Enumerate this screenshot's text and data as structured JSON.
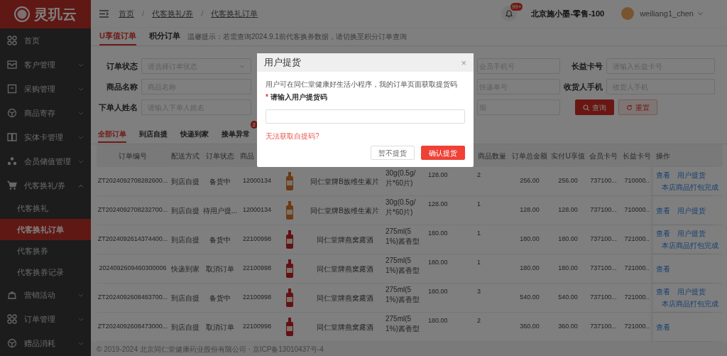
{
  "logo": {
    "text": "灵玑云"
  },
  "sidebar": {
    "items": [
      {
        "label": "首页",
        "kind": "link",
        "selected": false
      },
      {
        "label": "客户管理",
        "kind": "group",
        "expanded": false
      },
      {
        "label": "采购管理",
        "kind": "group",
        "expanded": false
      },
      {
        "label": "商品寄存",
        "kind": "group",
        "expanded": false
      },
      {
        "label": "实体卡管理",
        "kind": "group",
        "expanded": false
      },
      {
        "label": "会员储值管理",
        "kind": "group",
        "expanded": false
      },
      {
        "label": "代客换礼/券",
        "kind": "group",
        "expanded": true,
        "children": [
          {
            "label": "代客换礼",
            "selected": false
          },
          {
            "label": "代客换礼订单",
            "selected": true
          },
          {
            "label": "代客换券",
            "selected": false
          },
          {
            "label": "代客换券记录",
            "selected": false
          }
        ]
      },
      {
        "label": "营销活动",
        "kind": "group",
        "expanded": false
      },
      {
        "label": "订单管理",
        "kind": "group",
        "expanded": false
      },
      {
        "label": "赠品消耗",
        "kind": "group",
        "expanded": false
      }
    ]
  },
  "header": {
    "breadcrumb": [
      "首页",
      "代客换礼/券",
      "代客换礼订单"
    ],
    "separator": "/",
    "notification_badge": "99+",
    "store": "北京施小墨-零售-100",
    "user": "weiliang1_chen"
  },
  "subtabs": [
    {
      "label": "U享值订单",
      "selected": true
    },
    {
      "label": "积分订单",
      "selected": false
    }
  ],
  "tip": "温馨提示：若需查询2024.9.1前代客换券数据，请切换至积分订单查询",
  "filters": [
    {
      "left": {
        "label": "订单状态",
        "placeholder": "请选择订单状态",
        "kind": "select"
      },
      "middle": {
        "placeholder": "会员手机号"
      },
      "right": {
        "label": "长益卡号",
        "placeholder": "请输入长益卡号"
      }
    },
    {
      "left": {
        "label": "商品名称",
        "placeholder": "商品名称",
        "kind": "text"
      },
      "middle": {
        "placeholder": "快递单号"
      },
      "right": {
        "label": "收货人手机",
        "placeholder": "收货人手机"
      }
    },
    {
      "left": {
        "label": "下单人姓名",
        "placeholder": "请输入下单人姓名",
        "kind": "text"
      },
      "middle": {
        "placeholder": "期"
      },
      "buttons": [
        {
          "label": "查询",
          "kind": "primary"
        },
        {
          "label": "重置",
          "kind": "outline"
        }
      ]
    }
  ],
  "order_tabs": [
    {
      "label": "全部订单",
      "selected": true
    },
    {
      "label": "到店自提",
      "selected": false
    },
    {
      "label": "快递到家",
      "selected": false
    },
    {
      "label": "接单异常",
      "selected": false,
      "badge": "2"
    }
  ],
  "table": {
    "columns_left": [
      "订单编号",
      "配送方式",
      "订单状态",
      "商品"
    ],
    "columns_right": [
      "商品数量",
      "订单总金额",
      "实付U享值",
      "会员卡号",
      "长益卡号",
      "操作"
    ],
    "rows": [
      {
        "order_no": "ZT2024092708282600...",
        "delivery": "到店自提",
        "status": "备货中",
        "code": "12000134",
        "photo": {
          "color": "#6c3a15"
        },
        "name": "同仁堂牌B族维生素片",
        "spec_lines": [
          "30g(0.5g/",
          "片*60片)"
        ],
        "price": "128.00",
        "qty": "2",
        "total": "256.00",
        "paid": "256.00",
        "member_card": "737100...",
        "changyi_card": "710000..",
        "actions": [
          "查看",
          "用户提货",
          "本店商品打包完成"
        ]
      },
      {
        "order_no": "ZT2024092708232700...",
        "delivery": "到店自提",
        "status": "待用户提...",
        "code": "12000134",
        "photo": {
          "color": "#6c3a15"
        },
        "name": "同仁堂牌B族维生素片",
        "spec_lines": [
          "30g(0.5g/",
          "片*60片)"
        ],
        "price": "128.00",
        "qty": "1",
        "total": "128.00",
        "paid": "128.00",
        "member_card": "737100...",
        "changyi_card": "710000..",
        "actions": [
          "查看",
          "用户提货"
        ]
      },
      {
        "order_no": "ZT2024092614374400...",
        "delivery": "到店自提",
        "status": "备货中",
        "code": "22100998",
        "photo": {
          "color": "#641015"
        },
        "name": "同仁堂牌燕窝露酒",
        "spec_lines": [
          "275ml(5",
          "1%)酱香型"
        ],
        "price": "180.00",
        "qty": "1",
        "total": "180.00",
        "paid": "180.00",
        "member_card": "737100...",
        "changyi_card": "721000..",
        "actions": [
          "查看",
          "用户提货",
          "本店商品打包完成"
        ]
      },
      {
        "order_no": "2024092609460300006",
        "delivery": "快递到家",
        "status": "取消订单",
        "code": "22100998",
        "photo": {
          "color": "#641015"
        },
        "name": "同仁堂牌燕窝露酒",
        "spec_lines": [
          "275ml(5",
          "1%)酱香型"
        ],
        "price": "180.00",
        "qty": "1",
        "total": "180.00",
        "paid": "180.00",
        "member_card": "737100...",
        "changyi_card": "721000..",
        "actions": [
          "查看"
        ]
      },
      {
        "order_no": "ZT2024092608483700...",
        "delivery": "到店自提",
        "status": "备货中",
        "code": "22100998",
        "photo": {
          "color": "#641015"
        },
        "name": "同仁堂牌燕窝露酒",
        "spec_lines": [
          "275ml(5",
          "1%)酱香型"
        ],
        "price": "180.00",
        "qty": "3",
        "total": "540.00",
        "paid": "540.00",
        "member_card": "737100...",
        "changyi_card": "721000..",
        "actions": [
          "查看",
          "用户提货",
          "本店商品打包完成"
        ]
      },
      {
        "order_no": "ZT2024092608473000...",
        "delivery": "到店自提",
        "status": "取消订单",
        "code": "22100998",
        "photo": {
          "color": "#641015"
        },
        "name": "同仁堂牌燕窝露酒",
        "spec_lines": [
          "275ml(5",
          "1%)酱香型"
        ],
        "price": "180.00",
        "qty": "2",
        "total": "360.00",
        "paid": "360.00",
        "member_card": "737100...",
        "changyi_card": "721000..",
        "actions": [
          "查看"
        ]
      }
    ]
  },
  "footer": "© 2019-2024 北京同仁堂健康药业股份有限公司 · 京ICP备13010437号-4",
  "modal": {
    "title": "用户提货",
    "close": "×",
    "description": "用户可在同仁堂健康好生活小程序，我的订单页面获取提货码",
    "required_mark": "*",
    "field_label": "请输入用户提货码",
    "help_link": "无法获取自提码?",
    "buttons": [
      {
        "label": "暂不提货",
        "kind": "default"
      },
      {
        "label": "确认提货",
        "kind": "primary"
      }
    ]
  }
}
